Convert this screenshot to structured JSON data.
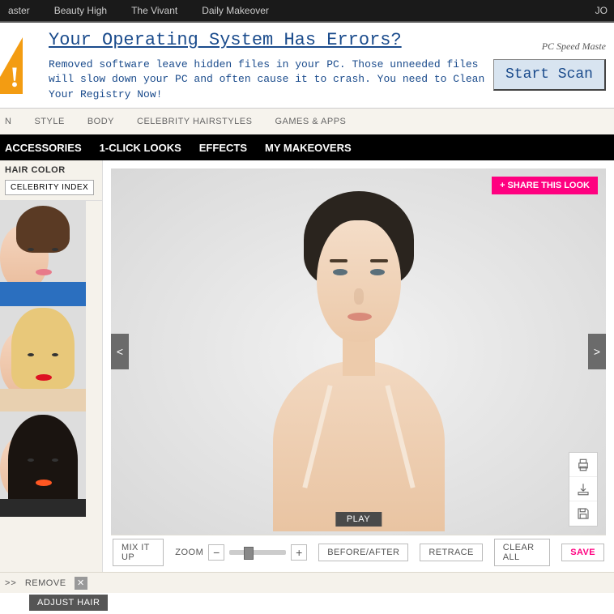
{
  "topnav": {
    "items": [
      "aster",
      "Beauty High",
      "The Vivant",
      "Daily Makeover"
    ],
    "right": "JO"
  },
  "ad": {
    "headline": "Your Operating System Has Errors?",
    "body": "Removed software leave hidden files in your PC. Those unneeded files will slow down your PC and often cause it to crash. You need to Clean Your Registry Now!",
    "tag": "PC Speed Maste",
    "cta": "Start Scan"
  },
  "nav_light": [
    "N",
    "STYLE",
    "BODY",
    "CELEBRITY HAIRSTYLES",
    "GAMES & APPS"
  ],
  "nav_dark": [
    "ACCESSORIES",
    "1-CLICK LOOKS",
    "EFFECTS",
    "MY MAKEOVERS"
  ],
  "sidebar": {
    "title": "HAIR COLOR",
    "celeb_btn": "CELEBRITY INDEX"
  },
  "stage": {
    "share": "+ SHARE THIS LOOK",
    "play": "PLAY",
    "prev": "<",
    "next": ">"
  },
  "toolbar": {
    "mixitup": "MIX IT UP",
    "zoom": "ZOOM",
    "minus": "−",
    "plus": "+",
    "before_after": "BEFORE/AFTER",
    "retrace": "RETRACE",
    "clear": "CLEAR ALL",
    "save": "SAVE"
  },
  "footer": {
    "arrow": ">>",
    "remove": "REMOVE",
    "adjust": "ADJUST HAIR"
  }
}
